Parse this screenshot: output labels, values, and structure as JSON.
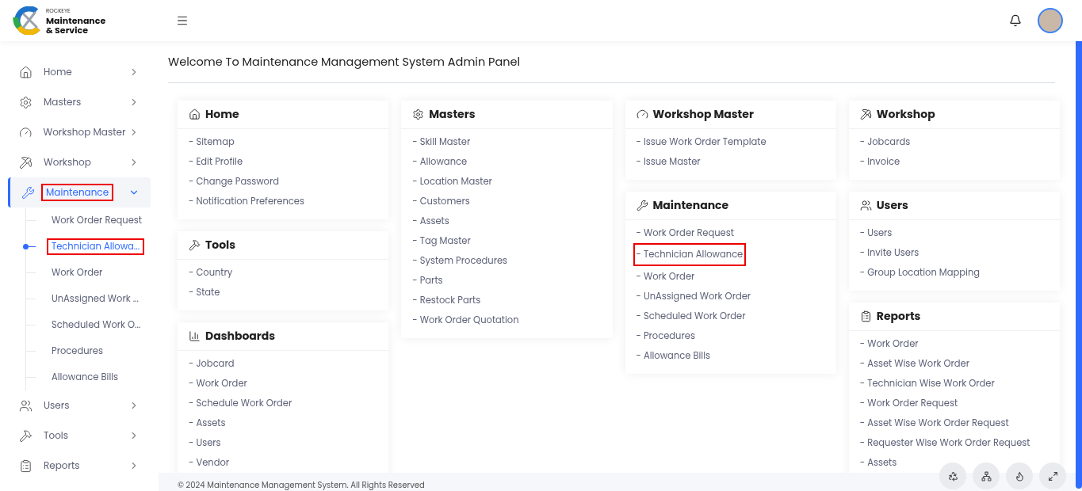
{
  "brand": {
    "small": "ROCKEYE",
    "name_line1": "Maintenance",
    "name_line2": "& Service"
  },
  "sidebar": {
    "items": [
      {
        "label": "Home",
        "expanded": false,
        "selected": false,
        "highlighted": false
      },
      {
        "label": "Masters",
        "expanded": false,
        "selected": false,
        "highlighted": false
      },
      {
        "label": "Workshop Master",
        "expanded": false,
        "selected": false,
        "highlighted": false
      },
      {
        "label": "Workshop",
        "expanded": false,
        "selected": false,
        "highlighted": false
      },
      {
        "label": "Maintenance",
        "expanded": true,
        "selected": true,
        "highlighted": true,
        "children": [
          {
            "label": "Work Order Request",
            "selected": false,
            "highlighted": false
          },
          {
            "label": "Technician Allowa...",
            "selected": true,
            "highlighted": true
          },
          {
            "label": "Work Order",
            "selected": false,
            "highlighted": false
          },
          {
            "label": "UnAssigned Work ...",
            "selected": false,
            "highlighted": false
          },
          {
            "label": "Scheduled Work O...",
            "selected": false,
            "highlighted": false
          },
          {
            "label": "Procedures",
            "selected": false,
            "highlighted": false
          },
          {
            "label": "Allowance Bills",
            "selected": false,
            "highlighted": false
          }
        ]
      },
      {
        "label": "Users",
        "expanded": false,
        "selected": false,
        "highlighted": false
      },
      {
        "label": "Tools",
        "expanded": false,
        "selected": false,
        "highlighted": false
      },
      {
        "label": "Reports",
        "expanded": false,
        "selected": false,
        "highlighted": false
      }
    ]
  },
  "page_title": "Welcome To Maintenance Management System Admin Panel",
  "columns": [
    [
      {
        "title": "Home",
        "kind": "home",
        "links": [
          {
            "label": "- Sitemap",
            "highlighted": false
          },
          {
            "label": "- Edit Profile",
            "highlighted": false
          },
          {
            "label": "- Change Password",
            "highlighted": false
          },
          {
            "label": "- Notification Preferences",
            "highlighted": false
          }
        ]
      },
      {
        "title": "Tools",
        "kind": "hammer",
        "links": [
          {
            "label": "- Country",
            "highlighted": false
          },
          {
            "label": "- State",
            "highlighted": false
          }
        ]
      },
      {
        "title": "Dashboards",
        "kind": "chart",
        "links": [
          {
            "label": "- Jobcard",
            "highlighted": false
          },
          {
            "label": "- Work Order",
            "highlighted": false
          },
          {
            "label": "- Schedule Work Order",
            "highlighted": false
          },
          {
            "label": "- Assets",
            "highlighted": false
          },
          {
            "label": "- Users",
            "highlighted": false
          },
          {
            "label": "- Vendor",
            "highlighted": false
          }
        ]
      }
    ],
    [
      {
        "title": "Masters",
        "kind": "gear",
        "links": [
          {
            "label": "- Skill Master",
            "highlighted": false
          },
          {
            "label": "- Allowance",
            "highlighted": false
          },
          {
            "label": "- Location Master",
            "highlighted": false
          },
          {
            "label": "- Customers",
            "highlighted": false
          },
          {
            "label": "- Assets",
            "highlighted": false
          },
          {
            "label": "- Tag Master",
            "highlighted": false
          },
          {
            "label": "- System Procedures",
            "highlighted": false
          },
          {
            "label": "- Parts",
            "highlighted": false
          },
          {
            "label": "- Restock Parts",
            "highlighted": false
          },
          {
            "label": "- Work Order Quotation",
            "highlighted": false
          }
        ]
      }
    ],
    [
      {
        "title": "Workshop Master",
        "kind": "gauge",
        "links": [
          {
            "label": "- Issue Work Order Template",
            "highlighted": false
          },
          {
            "label": "- Issue Master",
            "highlighted": false
          }
        ]
      },
      {
        "title": "Maintenance",
        "kind": "wrench",
        "links": [
          {
            "label": "- Work Order Request",
            "highlighted": false
          },
          {
            "label": "- Technician Allowance",
            "highlighted": true
          },
          {
            "label": "- Work Order",
            "highlighted": false
          },
          {
            "label": "- UnAssigned Work Order",
            "highlighted": false
          },
          {
            "label": "- Scheduled Work Order",
            "highlighted": false
          },
          {
            "label": "- Procedures",
            "highlighted": false
          },
          {
            "label": "- Allowance Bills",
            "highlighted": false
          }
        ]
      }
    ],
    [
      {
        "title": "Workshop",
        "kind": "tools",
        "links": [
          {
            "label": "- Jobcards",
            "highlighted": false
          },
          {
            "label": "- Invoice",
            "highlighted": false
          }
        ]
      },
      {
        "title": "Users",
        "kind": "users",
        "links": [
          {
            "label": "- Users",
            "highlighted": false
          },
          {
            "label": "- Invite Users",
            "highlighted": false
          },
          {
            "label": "- Group Location Mapping",
            "highlighted": false
          }
        ]
      },
      {
        "title": "Reports",
        "kind": "clipboard",
        "links": [
          {
            "label": "- Work Order",
            "highlighted": false
          },
          {
            "label": "- Asset Wise Work Order",
            "highlighted": false
          },
          {
            "label": "- Technician Wise Work Order",
            "highlighted": false
          },
          {
            "label": "- Work Order Request",
            "highlighted": false
          },
          {
            "label": "- Asset Wise Work Order Request",
            "highlighted": false
          },
          {
            "label": "- Requester Wise Work Order Request",
            "highlighted": false
          },
          {
            "label": "- Assets",
            "highlighted": false
          }
        ]
      }
    ]
  ],
  "footer": "© 2024 Maintenance Management System. All Rights Reserved"
}
